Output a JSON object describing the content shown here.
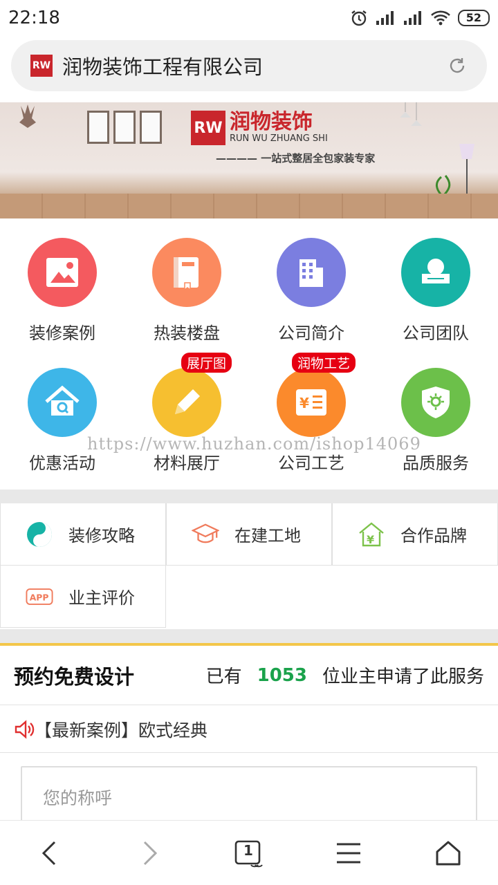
{
  "status": {
    "time": "22:18",
    "battery": "52"
  },
  "address_bar": {
    "logo_text": "RW",
    "title": "润物装饰工程有限公司"
  },
  "banner": {
    "logo_text": "RW",
    "brand_cn": "润物装饰",
    "brand_en": "RUN WU ZHUANG SHI",
    "slogan": "———— 一站式整居全包家装专家"
  },
  "menu": [
    {
      "label": "装修案例",
      "color": "#f45a5f",
      "icon": "image-icon"
    },
    {
      "label": "热装楼盘",
      "color": "#fb8a5f",
      "icon": "book-icon"
    },
    {
      "label": "公司简介",
      "color": "#7b7ee0",
      "icon": "building-icon"
    },
    {
      "label": "公司团队",
      "color": "#17b3a6",
      "icon": "sofa-icon"
    },
    {
      "label": "优惠活动",
      "color": "#3eb6e8",
      "icon": "house-search-icon"
    },
    {
      "label": "材料展厅",
      "color": "#f6bf30",
      "icon": "pencil-icon",
      "tag": "展厅图"
    },
    {
      "label": "公司工艺",
      "color": "#fb8a2c",
      "icon": "yen-list-icon",
      "tag": "润物工艺"
    },
    {
      "label": "品质服务",
      "color": "#6cc04a",
      "icon": "shield-icon"
    }
  ],
  "watermark": "https://www.huzhan.com/ishop14069",
  "entries": [
    {
      "label": "装修攻略",
      "icon": "yin-yang-icon"
    },
    {
      "label": "在建工地",
      "icon": "graduation-cap-icon"
    },
    {
      "label": "合作品牌",
      "icon": "yen-house-icon"
    },
    {
      "label": "业主评价",
      "icon": "app-icon"
    }
  ],
  "appointment": {
    "title": "预约免费设计",
    "prefix": "已有",
    "count": "1053",
    "suffix": "位业主申请了此服务"
  },
  "news": {
    "text": "【最新案例】欧式经典"
  },
  "form": {
    "name_placeholder": "您的称呼"
  },
  "bottom_nav": {
    "tabs_count": "1"
  }
}
